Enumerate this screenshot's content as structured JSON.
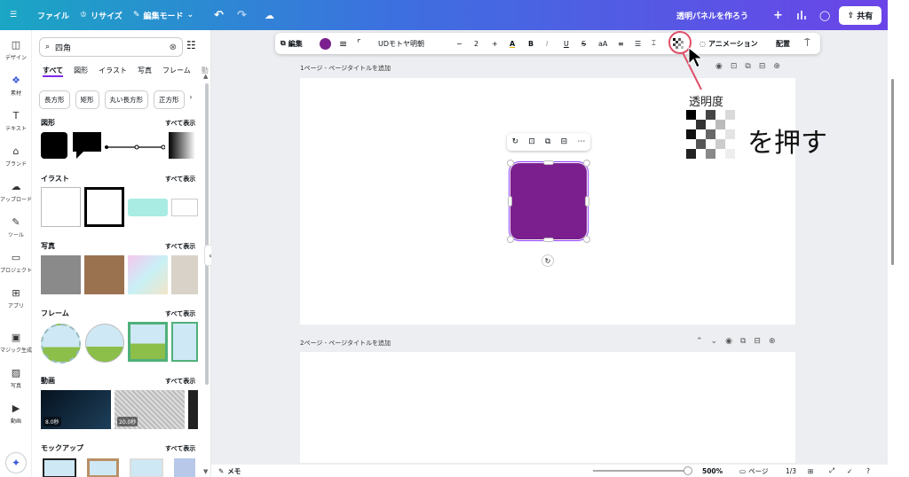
{
  "topbar": {
    "menu_icon": "hamburger-icon",
    "file": "ファイル",
    "resize": "リサイズ",
    "edit_mode": "編集モード",
    "doc_title": "透明パネルを作ろう",
    "share": "共有"
  },
  "rail": {
    "items": [
      {
        "label": "デザイン",
        "icon": "layout-icon"
      },
      {
        "label": "素材",
        "icon": "elements-icon"
      },
      {
        "label": "テキスト",
        "icon": "text-icon"
      },
      {
        "label": "ブランド",
        "icon": "brand-icon"
      },
      {
        "label": "アップロード",
        "icon": "upload-icon"
      },
      {
        "label": "ツール",
        "icon": "draw-icon"
      },
      {
        "label": "プロジェクト",
        "icon": "folder-icon"
      },
      {
        "label": "アプリ",
        "icon": "apps-icon"
      },
      {
        "label": "マジック生成",
        "icon": "magic-icon"
      },
      {
        "label": "写真",
        "icon": "photo-icon"
      },
      {
        "label": "動画",
        "icon": "video-icon"
      }
    ]
  },
  "panel": {
    "search_value": "四角",
    "tabs": [
      "すべて",
      "図形",
      "イラスト",
      "写真",
      "フレーム",
      "動"
    ],
    "chips": [
      "長方形",
      "矩形",
      "丸い長方形",
      "正方形"
    ],
    "see_all": "すべて表示",
    "sections": {
      "shapes": "図形",
      "illust": "イラスト",
      "photos": "写真",
      "frames": "フレーム",
      "video": "動画",
      "mockup": "モックアップ"
    },
    "video_durations": [
      "8.0秒",
      "20.0秒"
    ]
  },
  "toolbar": {
    "edit": "編集",
    "font": "UDモトヤ明朝",
    "font_size": "2",
    "animation": "アニメーション",
    "position": "配置",
    "fill_color": "#7b1f8e"
  },
  "pages": {
    "page1_label": "1ページ - ページタイトルを追加",
    "page2_label": "2ページ - ページタイトルを追加"
  },
  "annotation": {
    "title": "透明度",
    "caption": "を押す",
    "highlight_color": "#e0506a"
  },
  "bottombar": {
    "notes": "メモ",
    "zoom": "500%",
    "pages": "ページ",
    "page_count": "1/3"
  }
}
